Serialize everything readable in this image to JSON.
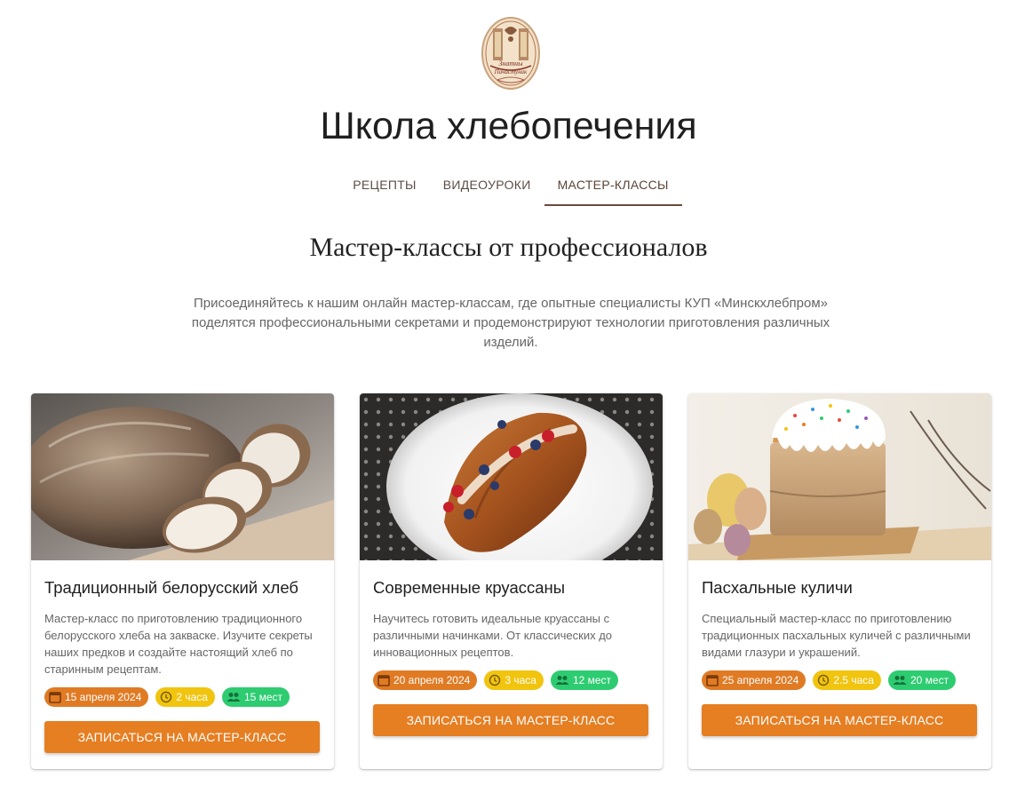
{
  "header": {
    "logo_text": "Знатны Пачастунак",
    "title": "Школа хлебопечения"
  },
  "nav": {
    "tabs": [
      {
        "label": "РЕЦЕПТЫ",
        "active": false
      },
      {
        "label": "ВИДЕОУРОКИ",
        "active": false
      },
      {
        "label": "МАСТЕР-КЛАССЫ",
        "active": true
      }
    ]
  },
  "section": {
    "title": "Мастер-классы от профессионалов",
    "description": "Присоединяйтесь к нашим онлайн мастер-классам, где опытные специалисты КУП «Минскхлебпром» поделятся профессиональными секретами и продемонстрируют технологии приготовления различных изделий."
  },
  "classes": [
    {
      "title": "Традиционный белорусский хлеб",
      "description": "Мастер-класс по приготовлению традиционного белорусского хлеба на закваске. Изучите секреты наших предков и создайте настоящий хлеб по старинным рецептам.",
      "date": "15 апреля 2024",
      "duration": "2 часа",
      "seats": "15 мест",
      "button": "ЗАПИСАТЬСЯ НА МАСТЕР-КЛАСС",
      "image": "sourdough-bread-photo"
    },
    {
      "title": "Современные круассаны",
      "description": "Научитесь готовить идеальные круассаны с различными начинками. От классических до инновационных рецептов.",
      "date": "20 апреля 2024",
      "duration": "3 часа",
      "seats": "12 мест",
      "button": "ЗАПИСАТЬСЯ НА МАСТЕР-КЛАСС",
      "image": "croissant-photo"
    },
    {
      "title": "Пасхальные куличи",
      "description": "Специальный мастер-класс по приготовлению традиционных пасхальных куличей с различными видами глазури и украшений.",
      "date": "25 апреля 2024",
      "duration": "2.5 часа",
      "seats": "20 мест",
      "button": "ЗАПИСАТЬСЯ НА МАСТЕР-КЛАСС",
      "image": "easter-cake-photo"
    }
  ],
  "colors": {
    "accent": "#e67e22",
    "date_badge": "#e07b24",
    "duration_badge": "#f1c40f",
    "seats_badge": "#2ecc71",
    "nav_active": "#6b4a3e"
  }
}
